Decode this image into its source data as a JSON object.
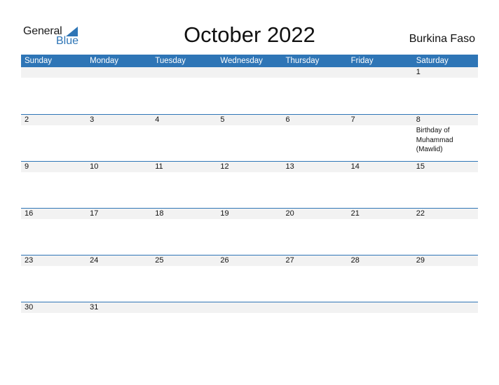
{
  "logo": {
    "line1": "General",
    "line2": "Blue",
    "icon": "triangle-icon",
    "color": "#2e75b6"
  },
  "title": "October 2022",
  "country": "Burkina Faso",
  "weekdays": [
    "Sunday",
    "Monday",
    "Tuesday",
    "Wednesday",
    "Thursday",
    "Friday",
    "Saturday"
  ],
  "weeks": [
    [
      {
        "day": ""
      },
      {
        "day": ""
      },
      {
        "day": ""
      },
      {
        "day": ""
      },
      {
        "day": ""
      },
      {
        "day": ""
      },
      {
        "day": "1"
      }
    ],
    [
      {
        "day": "2"
      },
      {
        "day": "3"
      },
      {
        "day": "4"
      },
      {
        "day": "5"
      },
      {
        "day": "6"
      },
      {
        "day": "7"
      },
      {
        "day": "8",
        "event": "Birthday of Muhammad (Mawlid)"
      }
    ],
    [
      {
        "day": "9"
      },
      {
        "day": "10"
      },
      {
        "day": "11"
      },
      {
        "day": "12"
      },
      {
        "day": "13"
      },
      {
        "day": "14"
      },
      {
        "day": "15"
      }
    ],
    [
      {
        "day": "16"
      },
      {
        "day": "17"
      },
      {
        "day": "18"
      },
      {
        "day": "19"
      },
      {
        "day": "20"
      },
      {
        "day": "21"
      },
      {
        "day": "22"
      }
    ],
    [
      {
        "day": "23"
      },
      {
        "day": "24"
      },
      {
        "day": "25"
      },
      {
        "day": "26"
      },
      {
        "day": "27"
      },
      {
        "day": "28"
      },
      {
        "day": "29"
      }
    ],
    [
      {
        "day": "30"
      },
      {
        "day": "31"
      },
      {
        "day": ""
      },
      {
        "day": ""
      },
      {
        "day": ""
      },
      {
        "day": ""
      },
      {
        "day": ""
      }
    ]
  ],
  "colors": {
    "accent": "#2e75b6",
    "band": "#f2f2f2"
  }
}
